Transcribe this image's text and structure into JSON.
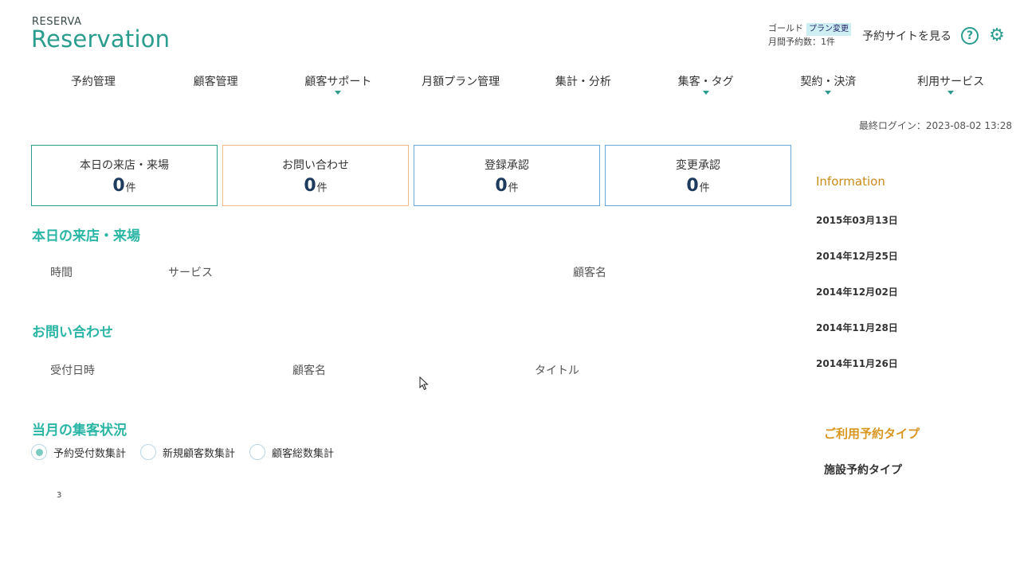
{
  "header": {
    "logo_small": "RESERVA",
    "logo_big": "Reservation",
    "plan_name": "ゴールド",
    "plan_change": "プラン変更",
    "monthly_count": "月間予約数：1件",
    "view_site": "予約サイトを見る"
  },
  "nav": {
    "items": [
      {
        "label": "予約管理"
      },
      {
        "label": "顧客管理"
      },
      {
        "label": "顧客サポート"
      },
      {
        "label": "月額プラン管理"
      },
      {
        "label": "集計・分析"
      },
      {
        "label": "集客・タグ"
      },
      {
        "label": "契約・決済"
      },
      {
        "label": "利用サービス"
      }
    ]
  },
  "last_login": "最終ログイン：2023-08-02 13:28",
  "cards": [
    {
      "title": "本日の来店・来場",
      "value": "0",
      "unit": "件",
      "color": "#2a9d8f"
    },
    {
      "title": "お問い合わせ",
      "value": "0",
      "unit": "件",
      "color": "#f0b98a"
    },
    {
      "title": "登録承認",
      "value": "0",
      "unit": "件",
      "color": "#6aa8d8"
    },
    {
      "title": "変更承認",
      "value": "0",
      "unit": "件",
      "color": "#6aa8d8"
    }
  ],
  "today": {
    "title": "本日の来店・来場",
    "col_time": "時間",
    "col_service": "サービス",
    "col_customer": "顧客名"
  },
  "inquiry": {
    "title": "お問い合わせ",
    "col_date": "受付日時",
    "col_customer": "顧客名",
    "col_title": "タイトル"
  },
  "monthly": {
    "title": "当月の集客状況",
    "options": [
      {
        "label": "予約受付数集計",
        "selected": true
      },
      {
        "label": "新規顧客数集計",
        "selected": false
      },
      {
        "label": "顧客総数集計",
        "selected": false
      }
    ],
    "chart_tick": "3"
  },
  "information": {
    "title": "Information",
    "dates": [
      "2015年03月13日",
      "2014年12月25日",
      "2014年12月02日",
      "2014年11月28日",
      "2014年11月26日"
    ]
  },
  "reservation_type": {
    "title": "ご利用予約タイプ",
    "name": "施設予約タイプ"
  }
}
